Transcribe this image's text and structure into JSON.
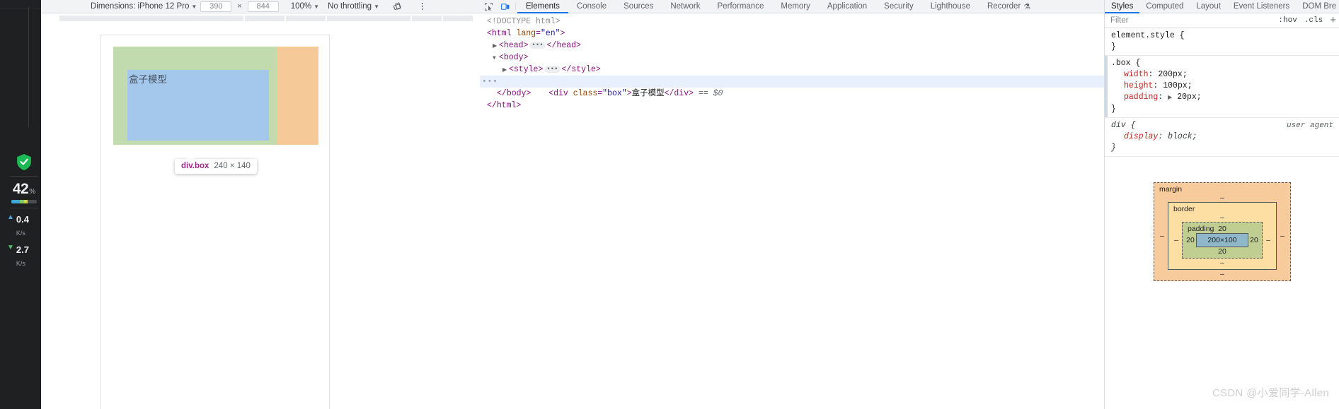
{
  "rail": {
    "shield_icon": "shield-check-icon",
    "cpu_value": "42",
    "cpu_unit": "%",
    "net_up_value": "0.4",
    "net_up_unit": "K/s",
    "net_down_value": "2.7",
    "net_down_unit": "K/s"
  },
  "device_toolbar": {
    "dimensions_label": "Dimensions: iPhone 12 Pro",
    "caret": "▼",
    "width_value": "390",
    "times": "×",
    "height_value": "844",
    "zoom_label": "100%",
    "throttling_label": "No throttling",
    "rotate_icon": "rotate-device-icon",
    "more_icon": "kebab-menu-icon"
  },
  "viewport": {
    "box_text": "盒子模型",
    "tooltip_selector": "div.box",
    "tooltip_dimensions": "240 × 140",
    "colors": {
      "content": "#a4c7ec",
      "padding": "#c1dbae",
      "margin": "#f6c998"
    }
  },
  "devtools_tabs": {
    "inspect_icon": "inspect-element-icon",
    "device_icon": "device-toolbar-icon",
    "items": [
      {
        "label": "Elements",
        "active": true
      },
      {
        "label": "Console",
        "active": false
      },
      {
        "label": "Sources",
        "active": false
      },
      {
        "label": "Network",
        "active": false
      },
      {
        "label": "Performance",
        "active": false
      },
      {
        "label": "Memory",
        "active": false
      },
      {
        "label": "Application",
        "active": false
      },
      {
        "label": "Security",
        "active": false
      },
      {
        "label": "Lighthouse",
        "active": false
      },
      {
        "label": "Recorder",
        "active": false,
        "badge_icon": "flask-icon"
      }
    ]
  },
  "elements_tree": {
    "lines": [
      {
        "indent": 0,
        "type": "doctype",
        "text": "<!DOCTYPE html>"
      },
      {
        "indent": 0,
        "type": "tag_open",
        "tag": "html",
        "attr": "lang",
        "value": "\"en\""
      },
      {
        "indent": 1,
        "type": "collapsed",
        "tag": "head",
        "triangle": "▶"
      },
      {
        "indent": 1,
        "type": "tag_open",
        "tag": "body",
        "triangle": "▼"
      },
      {
        "indent": 2,
        "type": "collapsed",
        "tag": "style",
        "triangle": "▶"
      },
      {
        "indent": 3,
        "type": "element_selected",
        "tag": "div",
        "attr": "class",
        "value": "\"box\"",
        "text": "盒子模型",
        "suffix": "== $0",
        "dots": "•••"
      },
      {
        "indent": 1,
        "type": "tag_close",
        "tag": "body"
      },
      {
        "indent": 0,
        "type": "tag_close",
        "tag": "html"
      }
    ]
  },
  "styles_panel": {
    "tabs": [
      {
        "label": "Styles",
        "active": true
      },
      {
        "label": "Computed",
        "active": false
      },
      {
        "label": "Layout",
        "active": false
      },
      {
        "label": "Event Listeners",
        "active": false
      },
      {
        "label": "DOM Bre",
        "active": false
      }
    ],
    "filter_placeholder": "Filter",
    "filter_value": "",
    "hov_label": ":hov",
    "cls_label": ".cls",
    "plus_label": "+",
    "rules": [
      {
        "selector": "element.style {",
        "close": "}",
        "origin": "",
        "declarations": []
      },
      {
        "selector": ".box {",
        "close": "}",
        "origin": "",
        "declarations": [
          {
            "name": "width",
            "value": "200px;"
          },
          {
            "name": "height",
            "value": "100px;"
          },
          {
            "name": "padding",
            "value": "20px;",
            "expandable": true
          }
        ]
      },
      {
        "selector": "div {",
        "close": "}",
        "origin": "user agent",
        "declarations": [
          {
            "name": "display",
            "value": "block;"
          }
        ]
      }
    ]
  },
  "box_model": {
    "margin_label": "margin",
    "margin_top": "–",
    "margin_right": "–",
    "margin_bottom": "–",
    "margin_left": "–",
    "border_label": "border",
    "border_top": "–",
    "border_right": "–",
    "border_bottom": "–",
    "border_left": "–",
    "padding_label": "padding",
    "padding_top": "20",
    "padding_right": "20",
    "padding_bottom": "20",
    "padding_left": "20",
    "content_size": "200×100"
  },
  "watermark": {
    "text": "CSDN @小爱同学-Allen"
  }
}
